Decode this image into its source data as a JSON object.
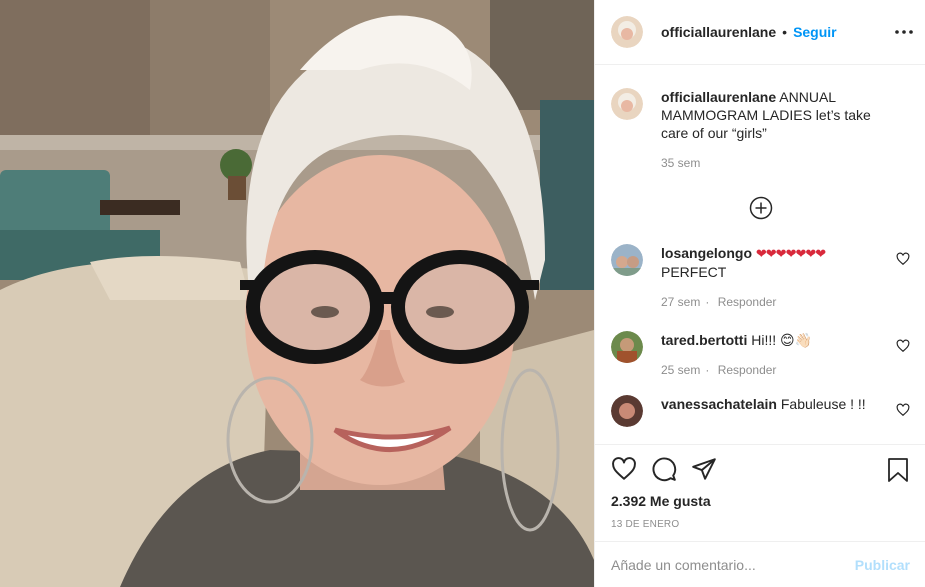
{
  "post": {
    "username": "officiallaurenlane",
    "follow_label": "Seguir",
    "separator": "•",
    "more_label": "•••",
    "caption_text": "ANNUAL MAMMOGRAM LADIES let’s take care of our “girls”",
    "caption_time": "35 sem",
    "comments": [
      {
        "user": "losangelongo",
        "text_suffix": "PERFECT",
        "emoji": "❤❤❤❤❤❤❤",
        "time": "27 sem",
        "reply": "Responder"
      },
      {
        "user": "tared.bertotti",
        "text": "Hi!!! 😊👋🏻",
        "time": "25 sem",
        "reply": "Responder"
      },
      {
        "user": "vanessachatelain",
        "text": "Fabuleuse ! !!"
      }
    ],
    "likes": "2.392 Me gusta",
    "date": "13 DE ENERO",
    "comment_placeholder": "Añade un comentario...",
    "publish_label": "Publicar"
  },
  "icons": {
    "more": "more-options-icon",
    "load_more": "plus-circle-icon",
    "like": "heart-icon",
    "comment": "comment-icon",
    "share": "paper-plane-icon",
    "save": "bookmark-icon"
  },
  "colors": {
    "link": "#0095f6",
    "text": "#262626",
    "muted": "#8e8e8e",
    "publish_disabled": "#b2dffc"
  }
}
